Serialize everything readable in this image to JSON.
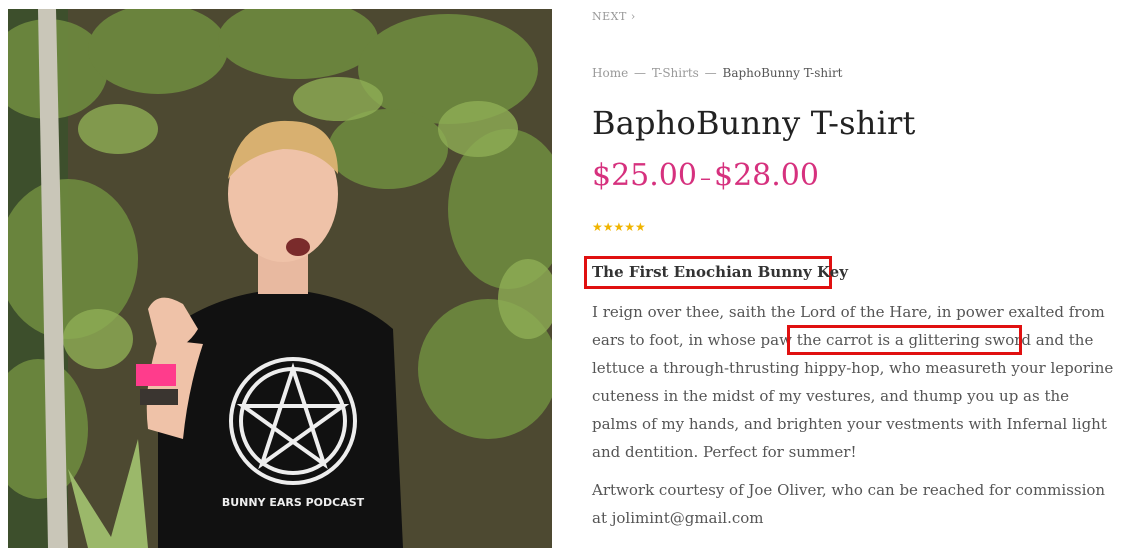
{
  "nav": {
    "next_label": "NEXT",
    "next_chevron": "›"
  },
  "breadcrumb": {
    "home": "Home",
    "category": "T-Shirts",
    "separator": "—",
    "current": "BaphoBunny T-shirt"
  },
  "product": {
    "title": "BaphoBunny T-shirt",
    "price_low": "$25.00",
    "price_separator": "–",
    "price_high": "$28.00",
    "stars": "★★★★★",
    "rating_fraction": 1.0,
    "subheading": "The First Enochian Bunny Key",
    "description_part1": "I reign over thee, saith the Lord of the Hare, in power exalted from ears to foot, in whose paw ",
    "description_highlight": "the carrot is a glittering sword",
    "description_part2": " and the lettuce a through-thrusting hippy-hop, who measureth your leporine cuteness in the midst of my vestures, and thump you up as the palms of my hands, and brighten your vestments with Infernal light and dentition. Perfect for summer!",
    "artwork_credit": "Artwork courtesy of Joe Oliver, who can be reached for commission at jolimint@gmail.com",
    "shirt_print_text": "BUNNY EARS PODCAST"
  },
  "colors": {
    "price": "#d6317e",
    "stars": "#f0b400",
    "highlight_box": "#e01010",
    "title": "#222222",
    "body_text": "#555555"
  }
}
